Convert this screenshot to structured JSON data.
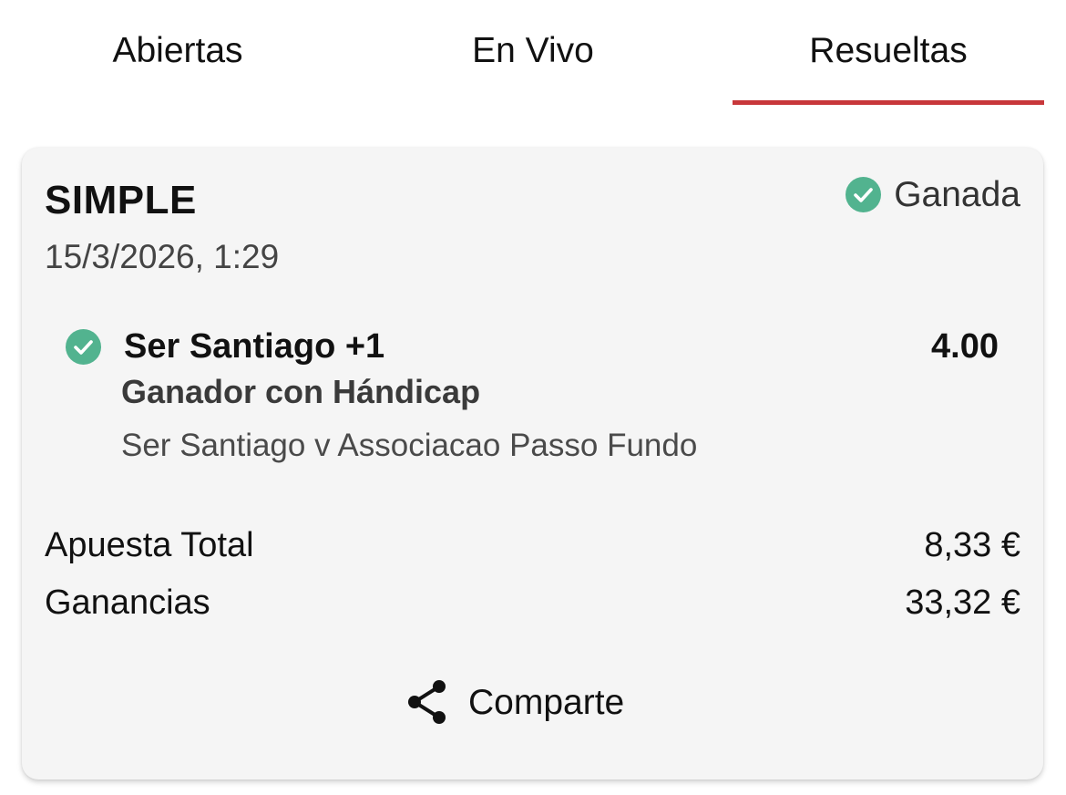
{
  "tabs": [
    {
      "label": "Abiertas",
      "active": false
    },
    {
      "label": "En Vivo",
      "active": false
    },
    {
      "label": "Resueltas",
      "active": true
    }
  ],
  "colors": {
    "accent": "#c8373a",
    "win_green": "#52b38f",
    "card_bg": "#f5f5f5"
  },
  "bet": {
    "type": "SIMPLE",
    "status": "Ganada",
    "status_icon": "check-circle-icon",
    "date": "15/3/2026, 1:29",
    "selection": {
      "name": "Ser Santiago +1",
      "odds": "4.00",
      "market": "Ganador con Hándicap",
      "event": "Ser Santiago v Associacao Passo Fundo",
      "status_icon": "check-circle-icon"
    },
    "stake_label": "Apuesta Total",
    "stake_value": "8,33 €",
    "winnings_label": "Ganancias",
    "winnings_value": "33,32 €",
    "share_label": "Comparte",
    "share_icon": "share-icon"
  }
}
